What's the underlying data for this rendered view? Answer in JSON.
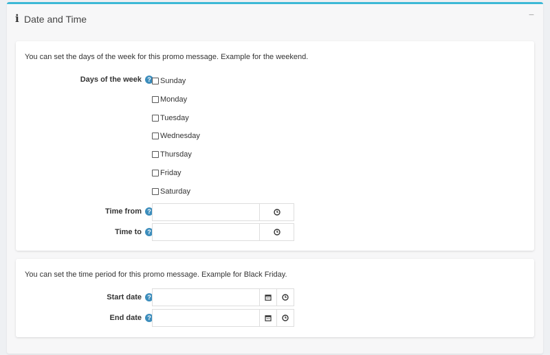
{
  "panel": {
    "title": "Date and Time",
    "collapse_symbol": "−"
  },
  "section_weekdays": {
    "description": "You can set the days of the week for this promo message. Example for the weekend.",
    "days_label": "Days of the week",
    "days": [
      "Sunday",
      "Monday",
      "Tuesday",
      "Wednesday",
      "Thursday",
      "Friday",
      "Saturday"
    ],
    "time_from_label": "Time from",
    "time_from_value": "",
    "time_to_label": "Time to",
    "time_to_value": ""
  },
  "section_period": {
    "description": "You can set the time period for this promo message. Example for Black Friday.",
    "start_date_label": "Start date",
    "start_date_value": "",
    "end_date_label": "End date",
    "end_date_value": ""
  },
  "icons": {
    "info": "info-icon",
    "help": "question-circle-icon",
    "clock": "clock-icon",
    "calendar": "calendar-icon"
  },
  "colors": {
    "accent_border": "#3cb8d6",
    "help_icon": "#3c8dbc"
  }
}
